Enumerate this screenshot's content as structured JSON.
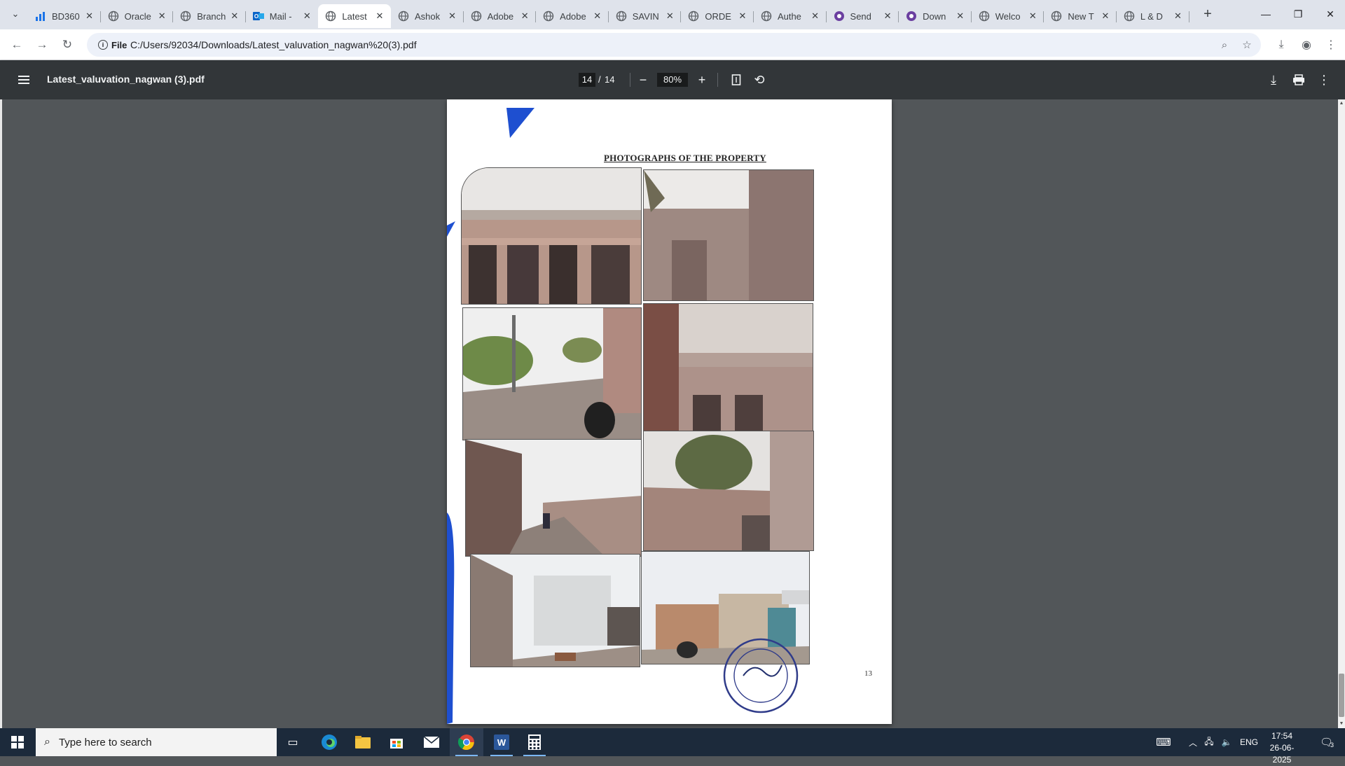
{
  "browser": {
    "tabs": [
      {
        "title": "BD360",
        "icon": "bar-chart-icon"
      },
      {
        "title": "Oracle",
        "icon": "globe-icon"
      },
      {
        "title": "Branch",
        "icon": "globe-icon"
      },
      {
        "title": "Mail -",
        "icon": "outlook-icon"
      },
      {
        "title": "Latest",
        "icon": "globe-icon",
        "active": true
      },
      {
        "title": "Ashok",
        "icon": "globe-icon"
      },
      {
        "title": "Adobe",
        "icon": "globe-icon"
      },
      {
        "title": "Adobe",
        "icon": "globe-icon"
      },
      {
        "title": "SAVIN",
        "icon": "globe-icon"
      },
      {
        "title": "ORDE",
        "icon": "globe-icon"
      },
      {
        "title": "Authe",
        "icon": "globe-icon"
      },
      {
        "title": "Send",
        "icon": "purple-app-icon"
      },
      {
        "title": "Down",
        "icon": "purple-app-icon"
      },
      {
        "title": "Welco",
        "icon": "globe-icon"
      },
      {
        "title": "New T",
        "icon": "globe-icon"
      },
      {
        "title": "L & D",
        "icon": "globe-icon"
      }
    ],
    "address": {
      "chip_label": "File",
      "url": "C:/Users/92034/Downloads/Latest_valuvation_nagwan%20(3).pdf"
    }
  },
  "pdf": {
    "file_name": "Latest_valuvation_nagwan (3).pdf",
    "current_page": "14",
    "page_separator": "/",
    "total_pages": "14",
    "zoom": "80%"
  },
  "document": {
    "heading": "PHOTOGRAPHS OF THE PROPERTY",
    "page_number": "13"
  },
  "taskbar": {
    "search_placeholder": "Type here to search",
    "language": "ENG",
    "time": "17:54",
    "date": "26-06-2025",
    "notification_count": "3"
  }
}
